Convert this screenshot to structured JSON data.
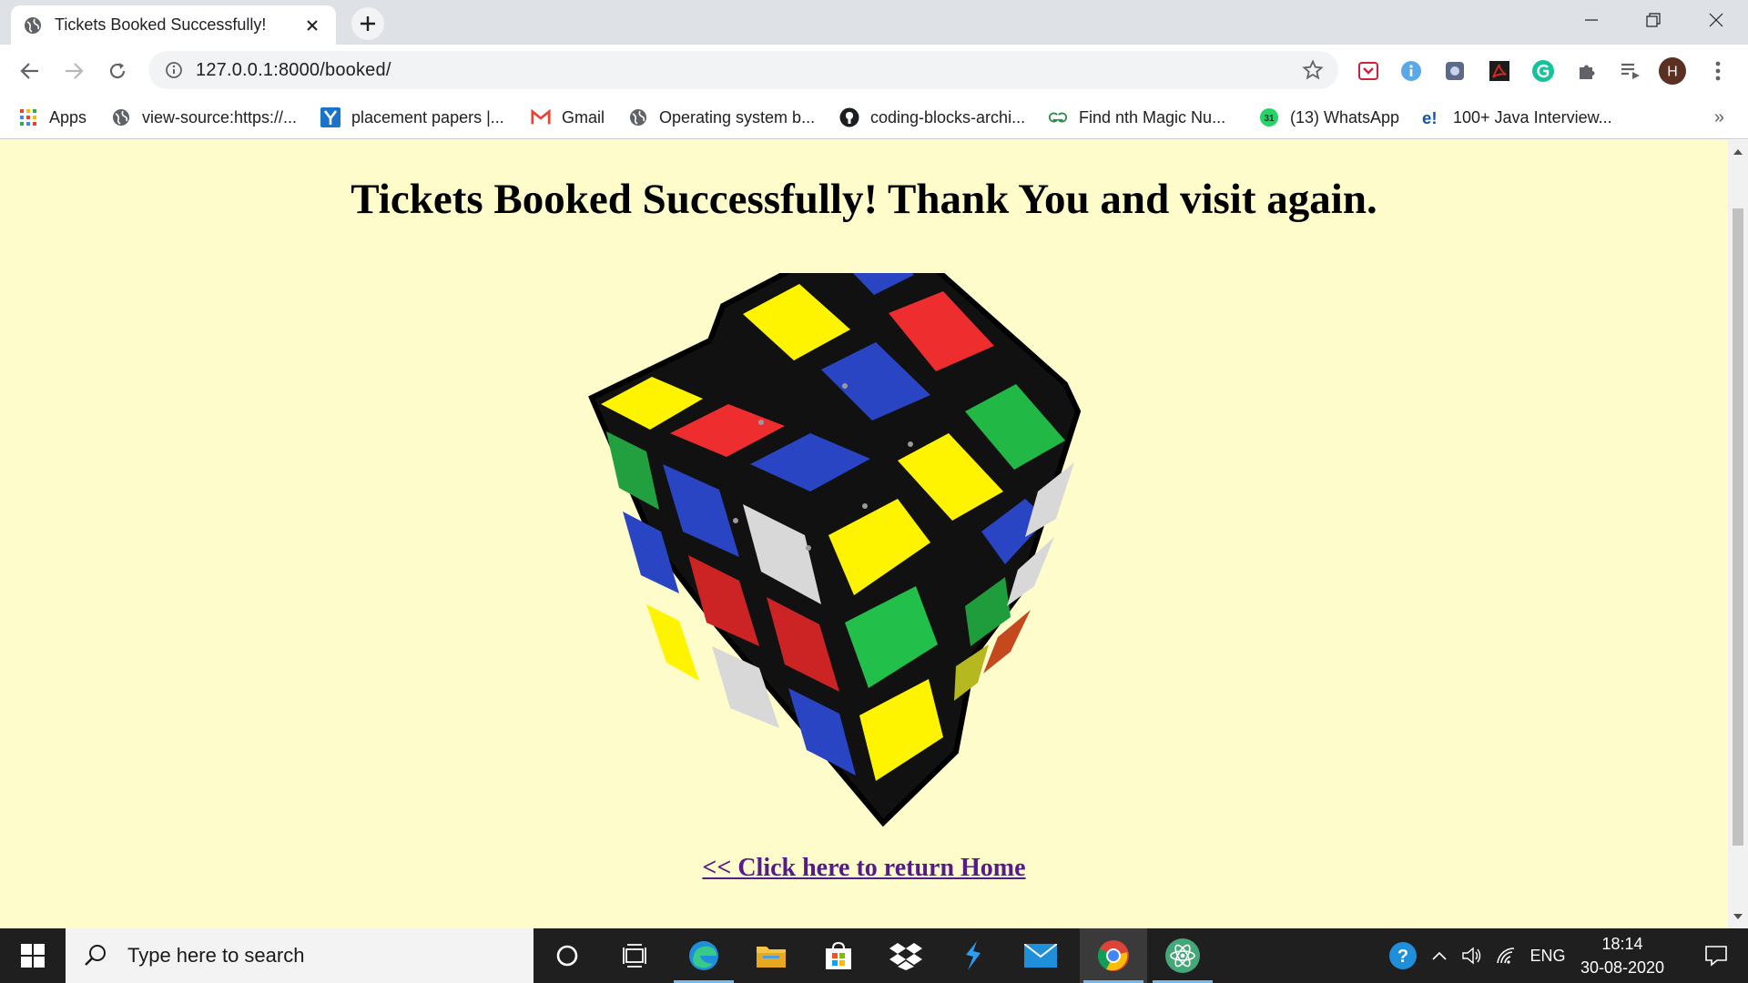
{
  "browser": {
    "tab_title": "Tickets Booked Successfully!",
    "url": "127.0.0.1:8000/booked/",
    "profile_initial": "H"
  },
  "bookmarks": [
    {
      "label": "Apps",
      "icon": "apps-grid-icon"
    },
    {
      "label": "view-source:https://...",
      "icon": "globe-icon"
    },
    {
      "label": "placement papers |...",
      "icon": "yahoo-icon"
    },
    {
      "label": "Gmail",
      "icon": "gmail-icon"
    },
    {
      "label": "Operating system b...",
      "icon": "globe-icon"
    },
    {
      "label": "coding-blocks-archi...",
      "icon": "github-icon"
    },
    {
      "label": "Find nth Magic Nu...",
      "icon": "geeksforgeeks-icon"
    },
    {
      "label": "(13) WhatsApp",
      "icon": "whatsapp-icon"
    },
    {
      "label": "100+ Java Interview...",
      "icon": "edureka-icon"
    }
  ],
  "page": {
    "heading": "Tickets Booked Successfully! Thank You and visit again.",
    "home_link": "<< Click here to return Home",
    "image": "rubiks-cube-illustration"
  },
  "taskbar": {
    "search_placeholder": "Type here to search",
    "language": "ENG",
    "time": "18:14",
    "date": "30-08-2020"
  },
  "colors": {
    "page_background": "#fffccc",
    "link_visited": "#551a8b",
    "cube_blue": "#2a45c4",
    "cube_yellow": "#fff400",
    "cube_red": "#ee2e2e",
    "cube_green": "#22b845",
    "cube_white": "#d8d8d8"
  }
}
